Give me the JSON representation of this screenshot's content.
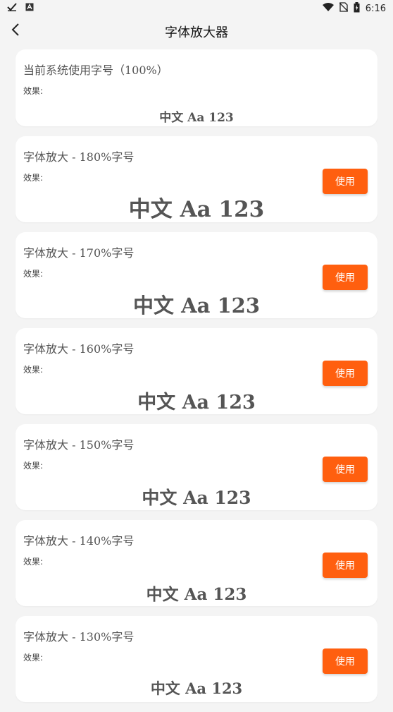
{
  "status_bar": {
    "time": "6:16",
    "icons": [
      "check-icon",
      "a-badge-icon",
      "wifi-icon",
      "no-sim-icon",
      "battery-icon"
    ]
  },
  "header": {
    "title": "字体放大器",
    "back_icon": "chevron-left-icon"
  },
  "current": {
    "title": "当前系统使用字号（100%）",
    "effect_label": "效果:",
    "sample": "中文 Aa 123"
  },
  "options": [
    {
      "title": "字体放大 - 180%字号",
      "effect_label": "效果:",
      "sample": "中文 Aa 123",
      "button": "使用",
      "scale": 1.8
    },
    {
      "title": "字体放大 - 170%字号",
      "effect_label": "效果:",
      "sample": "中文 Aa 123",
      "button": "使用",
      "scale": 1.7
    },
    {
      "title": "字体放大 - 160%字号",
      "effect_label": "效果:",
      "sample": "中文 Aa 123",
      "button": "使用",
      "scale": 1.6
    },
    {
      "title": "字体放大 - 150%字号",
      "effect_label": "效果:",
      "sample": "中文 Aa 123",
      "button": "使用",
      "scale": 1.5
    },
    {
      "title": "字体放大 - 140%字号",
      "effect_label": "效果:",
      "sample": "中文 Aa 123",
      "button": "使用",
      "scale": 1.4
    },
    {
      "title": "字体放大 - 130%字号",
      "effect_label": "效果:",
      "sample": "中文 Aa 123",
      "button": "使用",
      "scale": 1.3
    }
  ],
  "colors": {
    "accent": "#ff5f0f",
    "background": "#f4f4f4",
    "card": "#ffffff"
  }
}
